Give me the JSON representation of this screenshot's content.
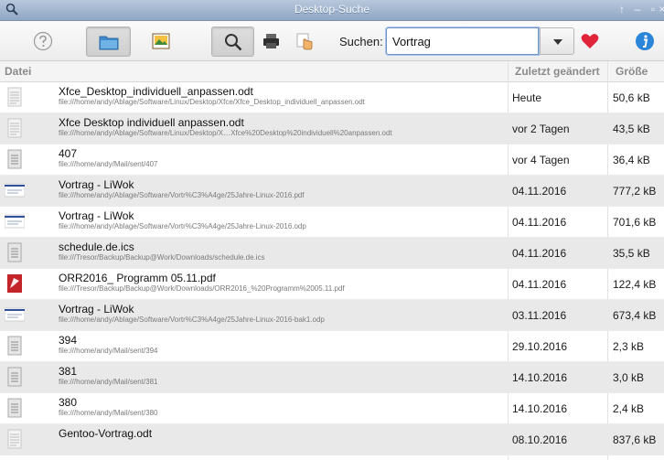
{
  "window": {
    "title": "Desktop-Suche"
  },
  "toolbar": {
    "search_label": "Suchen:",
    "search_value": "Vortrag",
    "icons": [
      "help-icon",
      "folder-icon",
      "image-icon",
      "search-icon",
      "printer-icon",
      "hand-icon",
      "heart-icon",
      "info-icon"
    ]
  },
  "table": {
    "columns": {
      "file": "Datei",
      "modified": "Zuletzt geändert",
      "size": "Größe"
    },
    "rows": [
      {
        "name": "Xfce_Desktop_individuell_anpassen.odt",
        "path": "file:///home/andy/Ablage/Software/Linux/Desktop/Xfce/Xfce_Desktop_individuell_anpassen.odt",
        "date": "Heute",
        "size": "50,6 kB",
        "icon": "doc"
      },
      {
        "name": "Xfce Desktop individuell anpassen.odt",
        "path": "file:///home/andy/Ablage/Software/Linux/Desktop/X…Xfce%20Desktop%20individuell%20anpassen.odt",
        "date": "vor 2 Tagen",
        "size": "43,5 kB",
        "icon": "doc"
      },
      {
        "name": "407",
        "path": "file:///home/andy/Mail/sent/407",
        "date": "vor 4 Tagen",
        "size": "36,4 kB",
        "icon": "text"
      },
      {
        "name": "Vortrag - LiWok",
        "path": "file:///home/andy/Ablage/Software/Vortr%C3%A4ge/25Jahre-Linux-2016.pdf",
        "date": "04.11.2016",
        "size": "777,2 kB",
        "icon": "slide"
      },
      {
        "name": "Vortrag - LiWok",
        "path": "file:///home/andy/Ablage/Software/Vortr%C3%A4ge/25Jahre-Linux-2016.odp",
        "date": "04.11.2016",
        "size": "701,6 kB",
        "icon": "slide"
      },
      {
        "name": "schedule.de.ics",
        "path": "file:///Tresor/Backup/Backup@Work/Downloads/schedule.de.ics",
        "date": "04.11.2016",
        "size": "35,5 kB",
        "icon": "text"
      },
      {
        "name": "ORR2016_ Programm 05.11.pdf",
        "path": "file:///Tresor/Backup/Backup@Work/Downloads/ORR2016_%20Programm%2005.11.pdf",
        "date": "04.11.2016",
        "size": "122,4 kB",
        "icon": "pdf"
      },
      {
        "name": "Vortrag - LiWok",
        "path": "file:///home/andy/Ablage/Software/Vortr%C3%A4ge/25Jahre-Linux-2016-bak1.odp",
        "date": "03.11.2016",
        "size": "673,4 kB",
        "icon": "slide"
      },
      {
        "name": "394",
        "path": "file:///home/andy/Mail/sent/394",
        "date": "29.10.2016",
        "size": "2,3 kB",
        "icon": "text"
      },
      {
        "name": "381",
        "path": "file:///home/andy/Mail/sent/381",
        "date": "14.10.2016",
        "size": "3,0 kB",
        "icon": "text"
      },
      {
        "name": "380",
        "path": "file:///home/andy/Mail/sent/380",
        "date": "14.10.2016",
        "size": "2,4 kB",
        "icon": "text"
      },
      {
        "name": "Gentoo-Vortrag.odt",
        "path": "",
        "date": "08.10.2016",
        "size": "837,6 kB",
        "icon": "doc"
      }
    ]
  }
}
